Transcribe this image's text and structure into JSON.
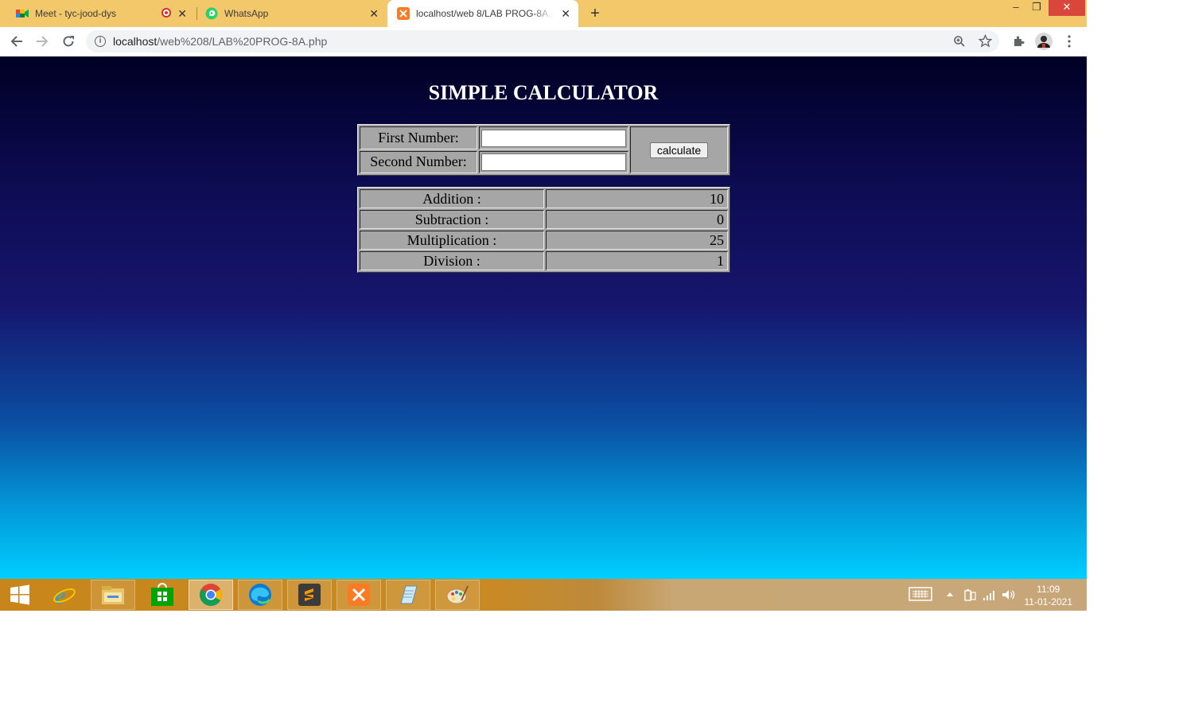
{
  "browser": {
    "tabs": [
      {
        "title": "Meet - tyc-jood-dys",
        "icon": "google-meet-icon",
        "recording": true
      },
      {
        "title": "WhatsApp",
        "icon": "whatsapp-icon"
      },
      {
        "title": "localhost/web 8/LAB PROG-8A.php",
        "icon": "xampp-icon",
        "active": true
      }
    ],
    "url_host": "localhost",
    "url_path": "/web%208/LAB%20PROG-8A.php"
  },
  "page": {
    "title": "SIMPLE CALCULATOR",
    "first_label": "First Number:",
    "first_value": "",
    "second_label": "Second Number:",
    "second_value": "",
    "button_label": "calculate",
    "results": [
      {
        "label": "Addition :",
        "value": "10"
      },
      {
        "label": "Subtraction :",
        "value": "0"
      },
      {
        "label": "Multiplication :",
        "value": "25"
      },
      {
        "label": "Division :",
        "value": "1"
      }
    ]
  },
  "taskbar": {
    "apps": [
      "start-icon",
      "internet-explorer-icon",
      "file-explorer-icon",
      "store-icon",
      "chrome-icon",
      "edge-icon",
      "sublime-text-icon",
      "xampp-icon",
      "notepad-icon",
      "paint-icon"
    ],
    "time": "11:09",
    "date": "11-01-2021"
  },
  "colors": {
    "tabstrip": "#f3c86b",
    "page_top": "#000024",
    "page_bottom": "#00cfff",
    "table_bg": "#a6a6a6"
  }
}
